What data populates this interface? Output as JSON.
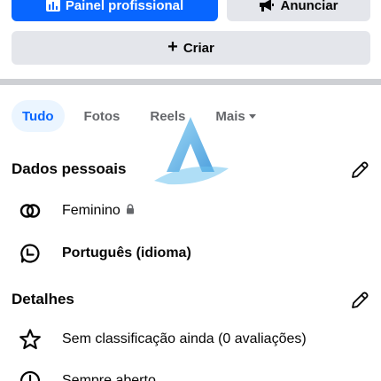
{
  "top_buttons": {
    "professional_dashboard": "Painel profissional",
    "advertise": "Anunciar",
    "create": "Criar"
  },
  "tabs": [
    {
      "label": "Tudo",
      "active": true
    },
    {
      "label": "Fotos",
      "active": false
    },
    {
      "label": "Reels",
      "active": false
    },
    {
      "label": "Mais",
      "active": false
    }
  ],
  "personal_data": {
    "title": "Dados pessoais",
    "items": [
      {
        "icon": "gender-icon",
        "label": "Feminino"
      },
      {
        "icon": "language-icon",
        "label": "Português (idioma)"
      }
    ]
  },
  "details": {
    "title": "Detalhes",
    "items": [
      {
        "icon": "star-icon",
        "label": "Sem classificação ainda (0 avaliações)"
      },
      {
        "icon": "clock-icon",
        "label": "Sempre aberto"
      }
    ]
  },
  "colors": {
    "accent": "#0866ff",
    "secondary_button": "#e4e6eb",
    "tab_active_bg": "#ebf5ff",
    "divider": "#ced0d4"
  }
}
